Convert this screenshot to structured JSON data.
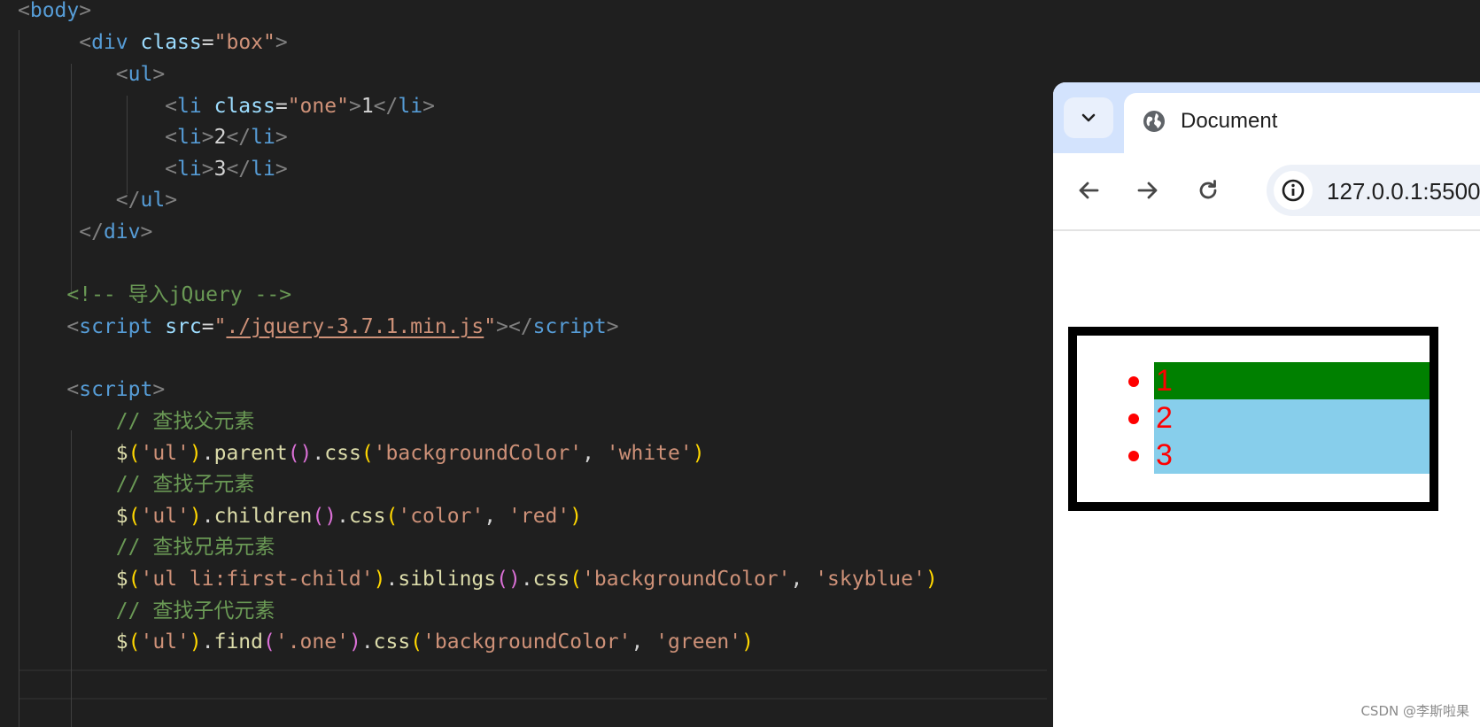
{
  "editor": {
    "lines": [
      [
        {
          "c": "t-punc",
          "t": "<"
        },
        {
          "c": "t-tag",
          "t": "body"
        },
        {
          "c": "t-punc",
          "t": ">"
        }
      ],
      [
        {
          "c": "t-text",
          "t": "     "
        },
        {
          "c": "t-punc",
          "t": "<"
        },
        {
          "c": "t-tag",
          "t": "div"
        },
        {
          "c": "t-text",
          "t": " "
        },
        {
          "c": "t-attr",
          "t": "class"
        },
        {
          "c": "t-text",
          "t": "="
        },
        {
          "c": "t-str",
          "t": "\"box\""
        },
        {
          "c": "t-punc",
          "t": ">"
        }
      ],
      [
        {
          "c": "t-text",
          "t": "        "
        },
        {
          "c": "t-punc",
          "t": "<"
        },
        {
          "c": "t-tag",
          "t": "ul"
        },
        {
          "c": "t-punc",
          "t": ">"
        }
      ],
      [
        {
          "c": "t-text",
          "t": "            "
        },
        {
          "c": "t-punc",
          "t": "<"
        },
        {
          "c": "t-tag",
          "t": "li"
        },
        {
          "c": "t-text",
          "t": " "
        },
        {
          "c": "t-attr",
          "t": "class"
        },
        {
          "c": "t-text",
          "t": "="
        },
        {
          "c": "t-str",
          "t": "\"one\""
        },
        {
          "c": "t-punc",
          "t": ">"
        },
        {
          "c": "t-text",
          "t": "1"
        },
        {
          "c": "t-punc",
          "t": "</"
        },
        {
          "c": "t-tag",
          "t": "li"
        },
        {
          "c": "t-punc",
          "t": ">"
        }
      ],
      [
        {
          "c": "t-text",
          "t": "            "
        },
        {
          "c": "t-punc",
          "t": "<"
        },
        {
          "c": "t-tag",
          "t": "li"
        },
        {
          "c": "t-punc",
          "t": ">"
        },
        {
          "c": "t-text",
          "t": "2"
        },
        {
          "c": "t-punc",
          "t": "</"
        },
        {
          "c": "t-tag",
          "t": "li"
        },
        {
          "c": "t-punc",
          "t": ">"
        }
      ],
      [
        {
          "c": "t-text",
          "t": "            "
        },
        {
          "c": "t-punc",
          "t": "<"
        },
        {
          "c": "t-tag",
          "t": "li"
        },
        {
          "c": "t-punc",
          "t": ">"
        },
        {
          "c": "t-text",
          "t": "3"
        },
        {
          "c": "t-punc",
          "t": "</"
        },
        {
          "c": "t-tag",
          "t": "li"
        },
        {
          "c": "t-punc",
          "t": ">"
        }
      ],
      [
        {
          "c": "t-text",
          "t": "        "
        },
        {
          "c": "t-punc",
          "t": "</"
        },
        {
          "c": "t-tag",
          "t": "ul"
        },
        {
          "c": "t-punc",
          "t": ">"
        }
      ],
      [
        {
          "c": "t-text",
          "t": "     "
        },
        {
          "c": "t-punc",
          "t": "</"
        },
        {
          "c": "t-tag",
          "t": "div"
        },
        {
          "c": "t-punc",
          "t": ">"
        }
      ],
      [],
      [
        {
          "c": "t-text",
          "t": "    "
        },
        {
          "c": "t-comment",
          "t": "<!-- 导入jQuery -->"
        }
      ],
      [
        {
          "c": "t-text",
          "t": "    "
        },
        {
          "c": "t-punc",
          "t": "<"
        },
        {
          "c": "t-tag",
          "t": "script"
        },
        {
          "c": "t-text",
          "t": " "
        },
        {
          "c": "t-attr",
          "t": "src"
        },
        {
          "c": "t-text",
          "t": "="
        },
        {
          "c": "t-str",
          "t": "\""
        },
        {
          "c": "t-link",
          "t": "./jquery-3.7.1.min.js"
        },
        {
          "c": "t-str",
          "t": "\""
        },
        {
          "c": "t-punc",
          "t": "></"
        },
        {
          "c": "t-tag",
          "t": "script"
        },
        {
          "c": "t-punc",
          "t": ">"
        }
      ],
      [],
      [
        {
          "c": "t-text",
          "t": "    "
        },
        {
          "c": "t-punc",
          "t": "<"
        },
        {
          "c": "t-tag",
          "t": "script"
        },
        {
          "c": "t-punc",
          "t": ">"
        }
      ],
      [
        {
          "c": "t-text",
          "t": "        "
        },
        {
          "c": "t-comment",
          "t": "// 查找父元素"
        }
      ],
      [
        {
          "c": "t-text",
          "t": "        "
        },
        {
          "c": "t-fn",
          "t": "$"
        },
        {
          "c": "t-b1",
          "t": "("
        },
        {
          "c": "t-str",
          "t": "'ul'"
        },
        {
          "c": "t-b1",
          "t": ")"
        },
        {
          "c": "t-text",
          "t": "."
        },
        {
          "c": "t-fn",
          "t": "parent"
        },
        {
          "c": "t-b2",
          "t": "()"
        },
        {
          "c": "t-text",
          "t": "."
        },
        {
          "c": "t-fn",
          "t": "css"
        },
        {
          "c": "t-b1",
          "t": "("
        },
        {
          "c": "t-str",
          "t": "'backgroundColor'"
        },
        {
          "c": "t-text",
          "t": ", "
        },
        {
          "c": "t-str",
          "t": "'white'"
        },
        {
          "c": "t-b1",
          "t": ")"
        }
      ],
      [
        {
          "c": "t-text",
          "t": "        "
        },
        {
          "c": "t-comment",
          "t": "// 查找子元素"
        }
      ],
      [
        {
          "c": "t-text",
          "t": "        "
        },
        {
          "c": "t-fn",
          "t": "$"
        },
        {
          "c": "t-b1",
          "t": "("
        },
        {
          "c": "t-str",
          "t": "'ul'"
        },
        {
          "c": "t-b1",
          "t": ")"
        },
        {
          "c": "t-text",
          "t": "."
        },
        {
          "c": "t-fn",
          "t": "children"
        },
        {
          "c": "t-b2",
          "t": "()"
        },
        {
          "c": "t-text",
          "t": "."
        },
        {
          "c": "t-fn",
          "t": "css"
        },
        {
          "c": "t-b1",
          "t": "("
        },
        {
          "c": "t-str",
          "t": "'color'"
        },
        {
          "c": "t-text",
          "t": ", "
        },
        {
          "c": "t-str",
          "t": "'red'"
        },
        {
          "c": "t-b1",
          "t": ")"
        }
      ],
      [
        {
          "c": "t-text",
          "t": "        "
        },
        {
          "c": "t-comment",
          "t": "// 查找兄弟元素"
        }
      ],
      [
        {
          "c": "t-text",
          "t": "        "
        },
        {
          "c": "t-fn",
          "t": "$"
        },
        {
          "c": "t-b1",
          "t": "("
        },
        {
          "c": "t-str",
          "t": "'ul li:first-child'"
        },
        {
          "c": "t-b1",
          "t": ")"
        },
        {
          "c": "t-text",
          "t": "."
        },
        {
          "c": "t-fn",
          "t": "siblings"
        },
        {
          "c": "t-b2",
          "t": "()"
        },
        {
          "c": "t-text",
          "t": "."
        },
        {
          "c": "t-fn",
          "t": "css"
        },
        {
          "c": "t-b1",
          "t": "("
        },
        {
          "c": "t-str",
          "t": "'backgroundColor'"
        },
        {
          "c": "t-text",
          "t": ", "
        },
        {
          "c": "t-str",
          "t": "'skyblue'"
        },
        {
          "c": "t-b1",
          "t": ")"
        }
      ],
      [
        {
          "c": "t-text",
          "t": "        "
        },
        {
          "c": "t-comment",
          "t": "// 查找子代元素"
        }
      ],
      [
        {
          "c": "t-text",
          "t": "        "
        },
        {
          "c": "t-fn",
          "t": "$"
        },
        {
          "c": "t-b1",
          "t": "("
        },
        {
          "c": "t-str",
          "t": "'ul'"
        },
        {
          "c": "t-b1",
          "t": ")"
        },
        {
          "c": "t-text",
          "t": "."
        },
        {
          "c": "t-fn",
          "t": "find"
        },
        {
          "c": "t-b2",
          "t": "("
        },
        {
          "c": "t-str",
          "t": "'.one'"
        },
        {
          "c": "t-b2",
          "t": ")"
        },
        {
          "c": "t-text",
          "t": "."
        },
        {
          "c": "t-fn",
          "t": "css"
        },
        {
          "c": "t-b1",
          "t": "("
        },
        {
          "c": "t-str",
          "t": "'backgroundColor'"
        },
        {
          "c": "t-text",
          "t": ", "
        },
        {
          "c": "t-str",
          "t": "'green'"
        },
        {
          "c": "t-b1",
          "t": ")"
        }
      ]
    ]
  },
  "browser": {
    "tab_title": "Document",
    "tab_icon": "globe-icon",
    "url": "127.0.0.1:5500",
    "nav_icons": [
      "back-arrow-icon",
      "forward-arrow-icon",
      "reload-icon",
      "info-icon",
      "chevron-down-icon"
    ],
    "page": {
      "box_border_color": "#000000",
      "items": [
        {
          "text": "1",
          "background": "#008000"
        },
        {
          "text": "2",
          "background": "#87ceeb"
        },
        {
          "text": "3",
          "background": "#87ceeb"
        }
      ],
      "text_color": "#ff0000"
    }
  },
  "watermark": "CSDN @李斯啦果"
}
